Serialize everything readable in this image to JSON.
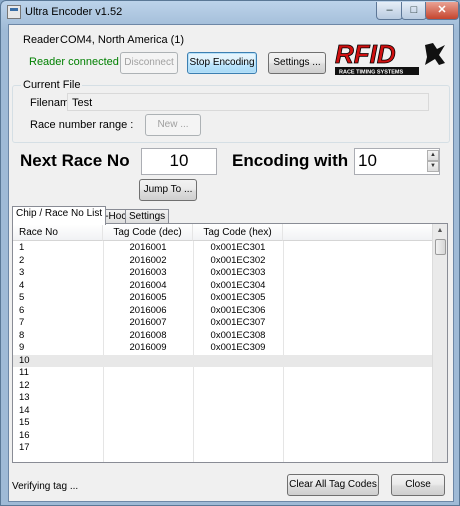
{
  "window": {
    "title": "Ultra Encoder v1.52",
    "min_glyph": "–",
    "max_glyph": "□",
    "close_glyph": "✕"
  },
  "reader": {
    "group_label": "Reader",
    "port": "COM4, North America (1)",
    "status": "Reader connected",
    "status_color": "#008000",
    "disconnect_label": "Disconnect",
    "stop_label": "Stop Encoding",
    "settings_label": "Settings ..."
  },
  "logo": {
    "text": "RFID",
    "tagline": "RACE TIMING SYSTEMS",
    "color": "#d01010"
  },
  "current_file": {
    "group_label": "Current File",
    "filename_label": "Filename",
    "filename_value": "Test",
    "range_label": "Race number range :",
    "new_label": "New ..."
  },
  "encode": {
    "next_label": "Next Race No",
    "next_value": "10",
    "with_label": "Encoding with",
    "with_value": "10",
    "jump_label": "Jump To ..."
  },
  "tabs": [
    "Chip / Race No List",
    "Ad-Hoc",
    "Settings"
  ],
  "grid": {
    "columns": [
      "Race No",
      "Tag Code (dec)",
      "Tag Code (hex)"
    ],
    "rows": [
      [
        "1",
        "2016001",
        "0x001EC301"
      ],
      [
        "2",
        "2016002",
        "0x001EC302"
      ],
      [
        "3",
        "2016003",
        "0x001EC303"
      ],
      [
        "4",
        "2016004",
        "0x001EC304"
      ],
      [
        "5",
        "2016005",
        "0x001EC305"
      ],
      [
        "6",
        "2016006",
        "0x001EC306"
      ],
      [
        "7",
        "2016007",
        "0x001EC307"
      ],
      [
        "8",
        "2016008",
        "0x001EC308"
      ],
      [
        "9",
        "2016009",
        "0x001EC309"
      ],
      [
        "10",
        "",
        ""
      ],
      [
        "11",
        "",
        ""
      ],
      [
        "12",
        "",
        ""
      ],
      [
        "13",
        "",
        ""
      ],
      [
        "14",
        "",
        ""
      ],
      [
        "15",
        "",
        ""
      ],
      [
        "16",
        "",
        ""
      ],
      [
        "17",
        "",
        ""
      ]
    ]
  },
  "footer": {
    "status": "Verifying tag ...",
    "clear_label": "Clear All Tag Codes",
    "close_label": "Close"
  }
}
